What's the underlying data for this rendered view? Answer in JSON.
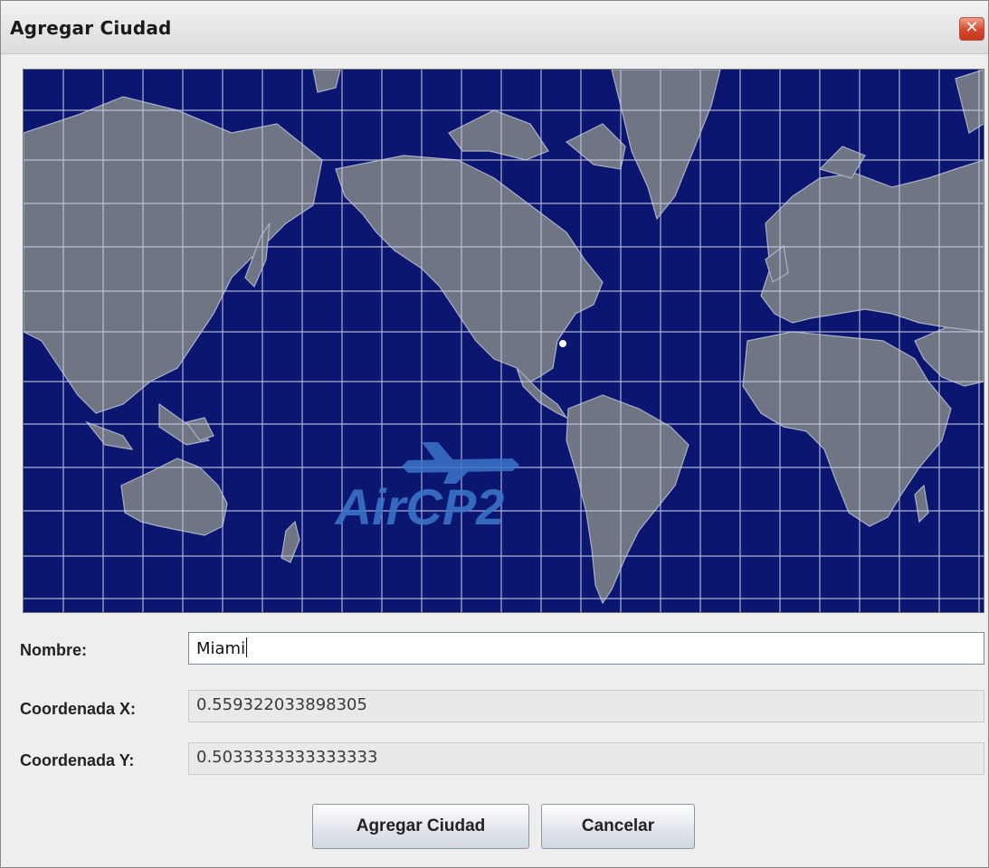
{
  "window": {
    "title": "Agregar Ciudad",
    "close_icon": "close-icon"
  },
  "map": {
    "watermark": "AirCP2",
    "logo_icon": "airplane-icon",
    "colors": {
      "ocean": "#0b1670",
      "land": "#6f7583",
      "grid": "#c9cde6",
      "watermark": "#3a73c9"
    },
    "selected_city_marker": "city-marker-icon"
  },
  "form": {
    "nombre_label": "Nombre:",
    "nombre_value": "Miami",
    "coord_x_label": "Coordenada X:",
    "coord_x_value": "0.559322033898305",
    "coord_y_label": "Coordenada Y:",
    "coord_y_value": "0.5033333333333333"
  },
  "buttons": {
    "add_label": "Agregar Ciudad",
    "cancel_label": "Cancelar"
  }
}
